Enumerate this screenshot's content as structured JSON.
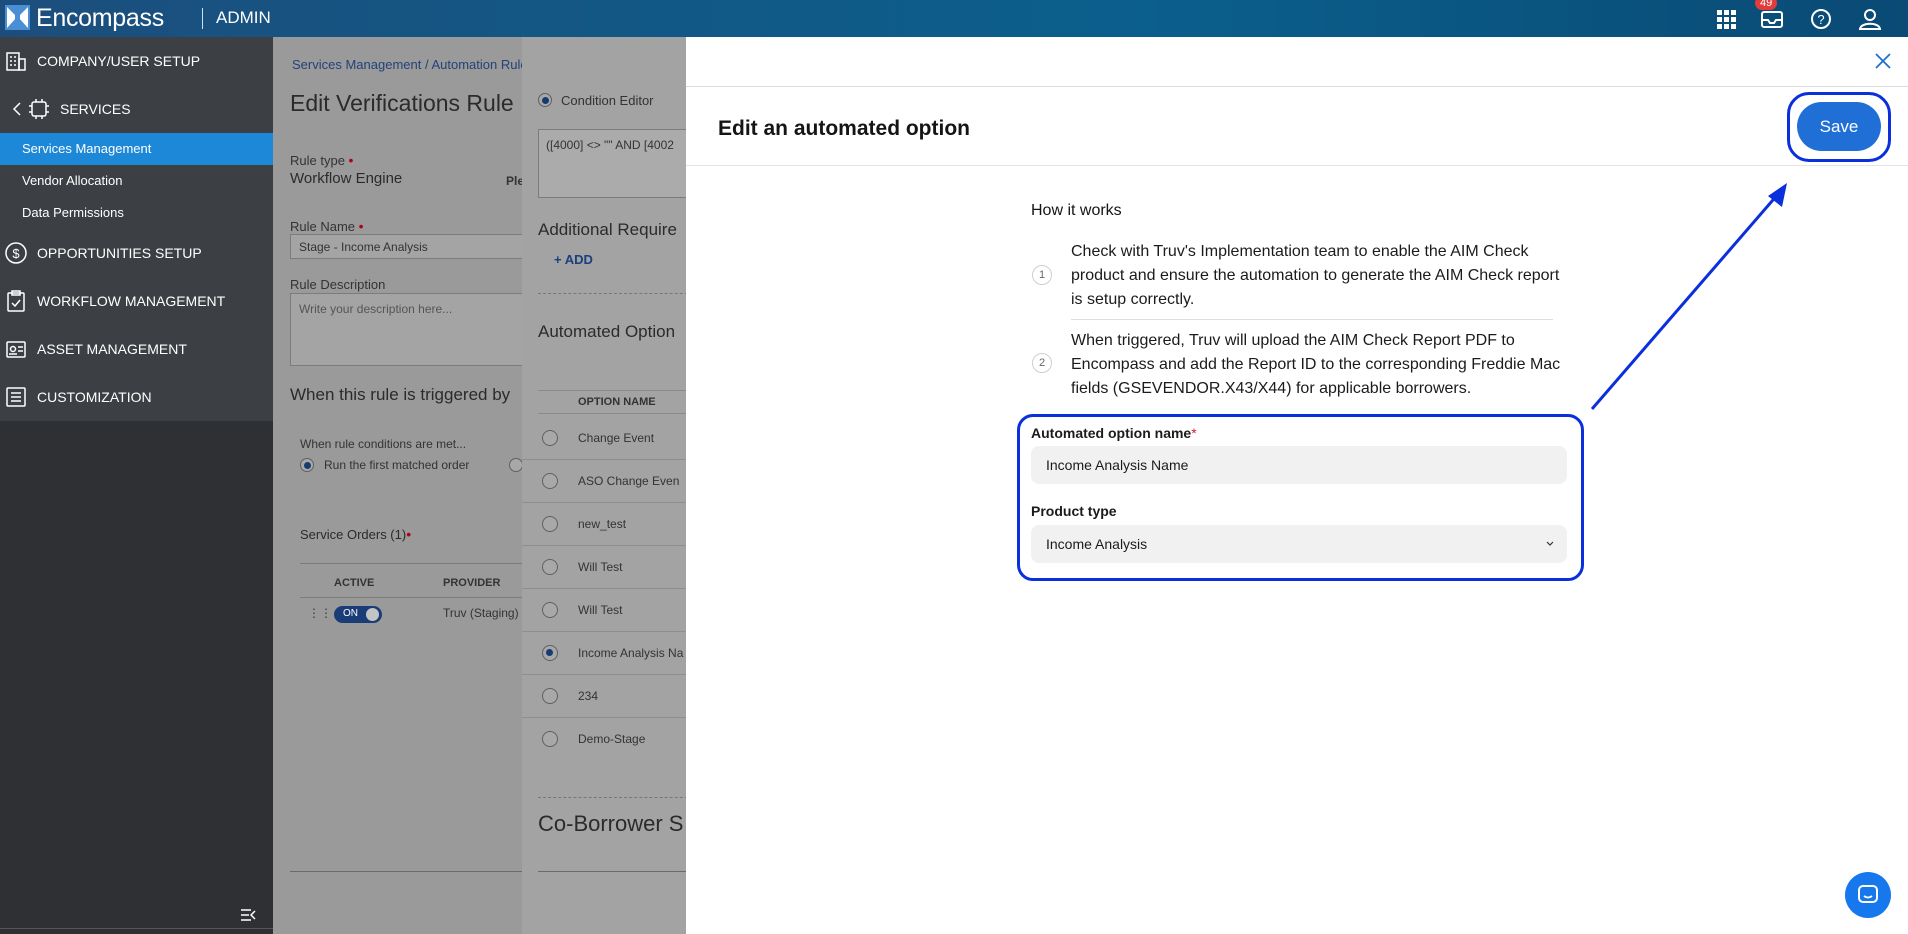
{
  "topbar": {
    "brand": "Encompass",
    "section": "ADMIN",
    "notification_count": "49",
    "icons": [
      "grid-icon",
      "inbox-icon",
      "help-icon",
      "user-icon"
    ]
  },
  "sidebar": {
    "groups": [
      {
        "label": "COMPANY/USER SETUP",
        "icon": "building-icon"
      },
      {
        "label": "SERVICES",
        "icon": "chip-icon"
      },
      {
        "label": "OPPORTUNITIES SETUP",
        "icon": "dollar-icon"
      },
      {
        "label": "WORKFLOW MANAGEMENT",
        "icon": "clipboard-icon"
      },
      {
        "label": "ASSET MANAGEMENT",
        "icon": "asset-icon"
      },
      {
        "label": "CUSTOMIZATION",
        "icon": "list-icon"
      }
    ],
    "sub_items": [
      {
        "label": "Services Management",
        "active": true
      },
      {
        "label": "Vendor Allocation",
        "active": false
      },
      {
        "label": "Data Permissions",
        "active": false
      }
    ]
  },
  "background_page": {
    "breadcrumb": "Services Management / Automation Rule",
    "title": "Edit Verifications Rule",
    "rule_type_label": "Rule type",
    "rule_type_value": "Workflow Engine",
    "plc_text": "Ple",
    "rule_name_label": "Rule Name",
    "rule_name_value": "Stage - Income Analysis",
    "rule_desc_label": "Rule Description",
    "rule_desc_placeholder": "Write your description here...",
    "triggered_heading": "When this rule is triggered by",
    "conditions_label": "When rule conditions are met...",
    "run_first_label": "Run the first matched order",
    "service_orders_label": "Service Orders (1)",
    "col_active": "ACTIVE",
    "col_provider": "PROVIDER",
    "toggle_label": "ON",
    "provider_value": "Truv (Staging)"
  },
  "middle_panel": {
    "condition_editor_label": "Condition Editor",
    "condition_text": "([4000] <> \"\" AND [4002",
    "additional_req": "Additional Require",
    "add_label": "+ ADD",
    "automated_options": "Automated Option",
    "col_option_name": "OPTION NAME",
    "options": [
      {
        "label": "Change Event",
        "checked": false
      },
      {
        "label": "ASO Change Even",
        "checked": false
      },
      {
        "label": "new_test",
        "checked": false
      },
      {
        "label": "Will Test",
        "checked": false
      },
      {
        "label": "Will Test",
        "checked": false
      },
      {
        "label": "Income Analysis Na",
        "checked": true
      },
      {
        "label": "234",
        "checked": false
      },
      {
        "label": "Demo-Stage",
        "checked": false
      }
    ],
    "co_borrower": "Co-Borrower S"
  },
  "modal": {
    "title": "Edit an automated option",
    "save_label": "Save",
    "how_title": "How it works",
    "steps": [
      {
        "num": "1",
        "text": "Check with Truv's Implementation team to enable the AIM Check product and ensure the automation to generate the AIM Check report is setup correctly."
      },
      {
        "num": "2",
        "text": "When triggered, Truv will upload the AIM Check Report PDF to Encompass and add the Report ID to the corresponding Freddie Mac fields (GSEVENDOR.X43/X44) for applicable borrowers."
      }
    ],
    "option_name_label": "Automated option name",
    "option_name_required": "*",
    "option_name_value": "Income Analysis Name",
    "product_type_label": "Product type",
    "product_type_value": "Income Analysis"
  },
  "colors": {
    "annotation": "#0a2fdc",
    "save_button": "#1f6fd6",
    "active_nav": "#1e88d8",
    "topbar": "#0b5f8c"
  }
}
